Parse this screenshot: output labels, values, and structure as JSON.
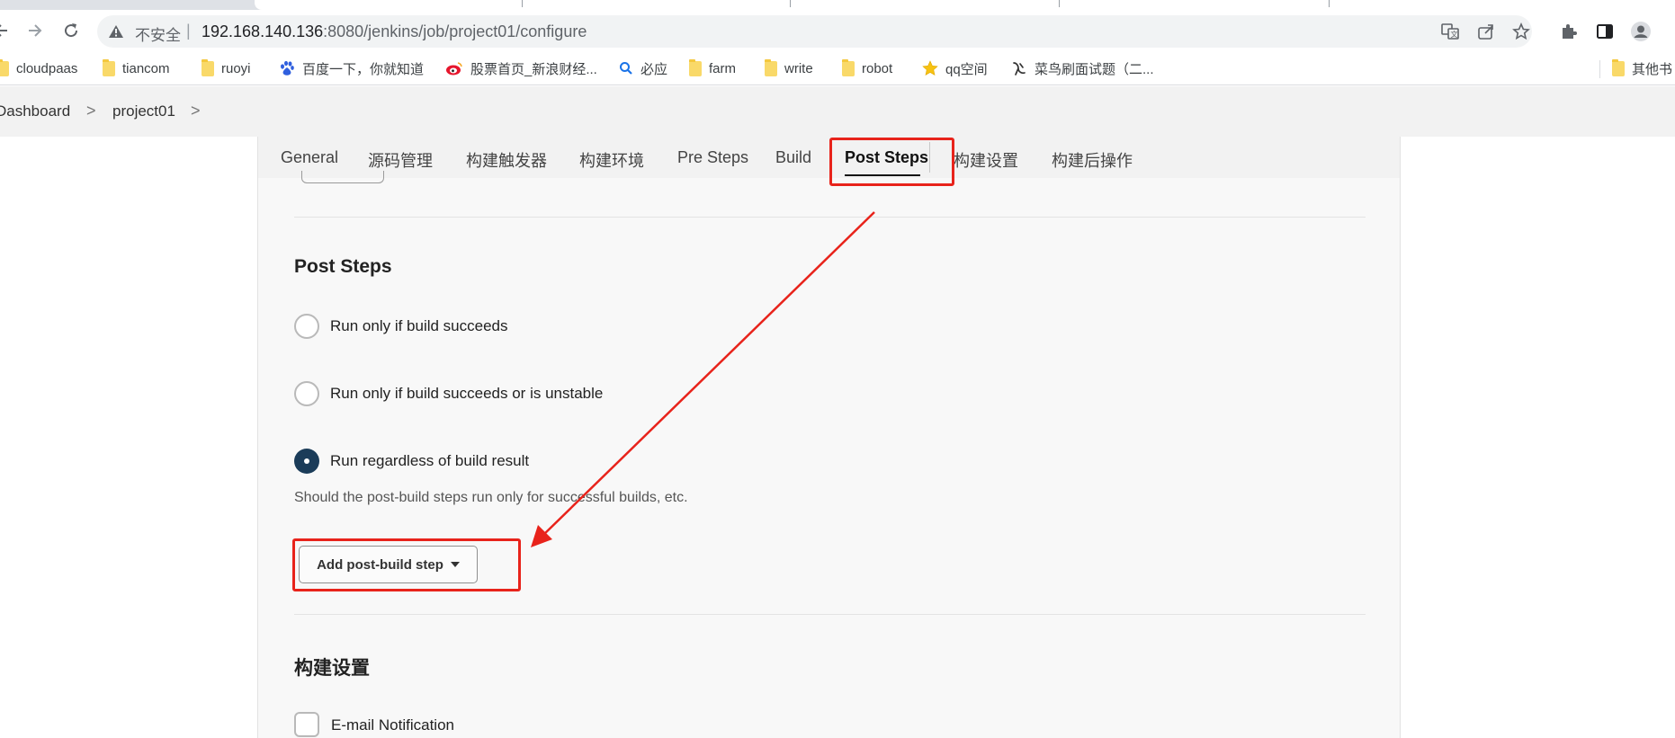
{
  "browser": {
    "security_label": "不安全",
    "separator": "|",
    "url_host": "192.168.140.136",
    "url_rest": ":8080/jenkins/job/project01/configure"
  },
  "bookmarks": [
    {
      "label": "cloudpaas",
      "icon": "folder-icon"
    },
    {
      "label": "tiancom",
      "icon": "folder-icon"
    },
    {
      "label": "ruoyi",
      "icon": "folder-icon"
    },
    {
      "label": "百度一下，你就知道",
      "icon": "baidu-paw-icon"
    },
    {
      "label": "股票首页_新浪财经...",
      "icon": "weibo-icon"
    },
    {
      "label": "必应",
      "icon": "bing-search-icon"
    },
    {
      "label": "farm",
      "icon": "folder-icon"
    },
    {
      "label": "write",
      "icon": "folder-icon"
    },
    {
      "label": "robot",
      "icon": "folder-icon"
    },
    {
      "label": "qq空间",
      "icon": "qzone-star-icon"
    },
    {
      "label": "菜鸟刷面试题（二...",
      "icon": "runoob-bird-icon"
    },
    {
      "label": "其他书",
      "icon": "folder-icon"
    }
  ],
  "breadcrumb": {
    "items": [
      "Dashboard",
      "project01"
    ],
    "separator": ">"
  },
  "tabs": [
    {
      "label": "General"
    },
    {
      "label": "源码管理"
    },
    {
      "label": "构建触发器"
    },
    {
      "label": "构建环境"
    },
    {
      "label": "Pre Steps"
    },
    {
      "label": "Build"
    },
    {
      "label": "Post Steps",
      "active": true
    },
    {
      "label": "构建设置"
    },
    {
      "label": "构建后操作"
    }
  ],
  "post_steps": {
    "title": "Post Steps",
    "options": [
      {
        "label": "Run only if build succeeds",
        "checked": false
      },
      {
        "label": "Run only if build succeeds or is unstable",
        "checked": false
      },
      {
        "label": "Run regardless of build result",
        "checked": true
      }
    ],
    "help": "Should the post-build steps run only for successful builds, etc.",
    "add_button": "Add post-build step"
  },
  "build_settings": {
    "title": "构建设置",
    "email_label": "E-mail Notification",
    "email_checked": false
  },
  "annotation": {
    "color": "#e8231b"
  },
  "colors": {
    "radio_checked": "#1b3c59",
    "panel_bg": "#f8f8f8"
  }
}
